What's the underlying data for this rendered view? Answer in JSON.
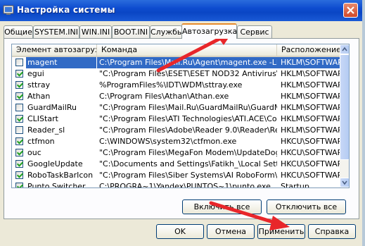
{
  "window": {
    "title": "Настройка системы"
  },
  "tabs": [
    {
      "label": "Общие"
    },
    {
      "label": "SYSTEM.INI"
    },
    {
      "label": "WIN.INI"
    },
    {
      "label": "BOOT.INI"
    },
    {
      "label": "Службы"
    },
    {
      "label": "Автозагрузка"
    },
    {
      "label": "Сервис"
    }
  ],
  "active_tab": "Автозагрузка",
  "columns": {
    "item": "Элемент автозагрузки",
    "command": "Команда",
    "location": "Расположение"
  },
  "rows": [
    {
      "item": "magent",
      "command": "C:\\Program Files\\Mail.Ru\\Agent\\magent.exe -LM",
      "location": "HKLM\\SOFTWARE",
      "checked": false,
      "selected": true
    },
    {
      "item": "egui",
      "command": "\"C:\\Program Files\\ESET\\ESET NOD32 Antivirus\\egui.ex...",
      "location": "HKLM\\SOFTWARE",
      "checked": true,
      "selected": false
    },
    {
      "item": "sttray",
      "command": "%ProgramFiles%\\IDT\\WDM\\sttray.exe",
      "location": "HKLM\\SOFTWARE",
      "checked": true,
      "selected": false
    },
    {
      "item": "Athan",
      "command": "C:\\Program Files\\Athan\\Athan.exe",
      "location": "HKLM\\SOFTWARE",
      "checked": true,
      "selected": false
    },
    {
      "item": "GuardMailRu",
      "command": "\"C:\\Program Files\\Mail.Ru\\GuardMailRu\\GuardMailRu.exe\" /gui",
      "location": "HKLM\\SOFTWARE",
      "checked": false,
      "selected": false
    },
    {
      "item": "CLIStart",
      "command": "\"C:\\Program Files\\ATI Technologies\\ATI.ACE\\Core-Stat...",
      "location": "HKLM\\SOFTWARE",
      "checked": true,
      "selected": false
    },
    {
      "item": "Reader_sl",
      "command": "\"C:\\Program Files\\Adobe\\Reader 9.0\\Reader\\Reader_s...",
      "location": "HKLM\\SOFTWARE",
      "checked": false,
      "selected": false
    },
    {
      "item": "ctfmon",
      "command": "C:\\WINDOWS\\system32\\ctfmon.exe",
      "location": "HKCU\\SOFTWARE",
      "checked": true,
      "selected": false
    },
    {
      "item": "ouc",
      "command": "\"C:\\Program Files\\MegaFon Modem\\UpdateDog\\ouc.exe\"",
      "location": "HKCU\\SOFTWARE",
      "checked": true,
      "selected": false
    },
    {
      "item": "GoogleUpdate",
      "command": "\"C:\\Documents and Settings\\Fatikh_\\Local Settings\\Ap...",
      "location": "HKCU\\SOFTWARE",
      "checked": true,
      "selected": false
    },
    {
      "item": "RoboTaskBarIcon",
      "command": "\"C:\\Program Files\\Siber Systems\\AI RoboForm\\RoboTa...",
      "location": "HKCU\\SOFTWARE",
      "checked": true,
      "selected": false
    },
    {
      "item": "Punto Switcher",
      "command": "C:\\PROGRA~1\\Yandex\\PUNTOS~1\\punto.exe",
      "location": "Startup",
      "checked": true,
      "selected": false
    }
  ],
  "buttons": {
    "enable_all": "Включить все",
    "disable_all": "Отключить все",
    "ok": "OK",
    "cancel": "Отмена",
    "apply": "Применить",
    "help": "Справка"
  },
  "colors": {
    "titlebar": "#0a46c4",
    "selection": "#316ac5",
    "annotation_arrow": "#e8262a"
  }
}
